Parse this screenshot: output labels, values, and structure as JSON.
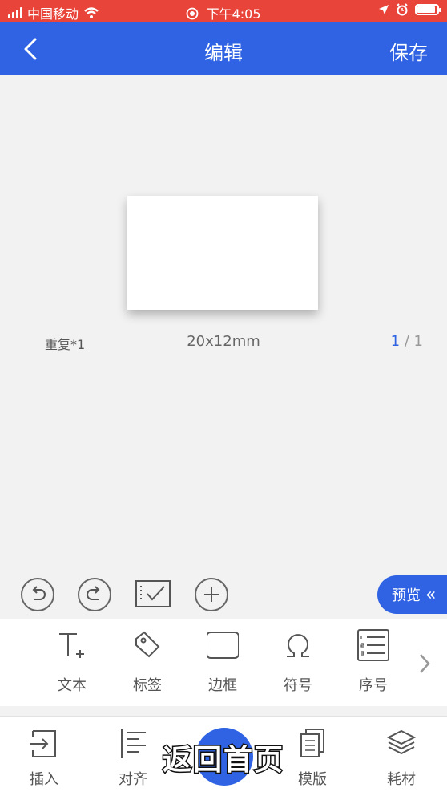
{
  "status_bar": {
    "carrier": "中国移动",
    "time": "下午4:05",
    "battery_percent": 90
  },
  "nav": {
    "title": "编辑",
    "save_label": "保存"
  },
  "canvas": {
    "repeat": "重复*1",
    "size": "20x12mm",
    "page_current": "1",
    "page_sep": " / ",
    "page_total": "1"
  },
  "preview": {
    "label": "预览",
    "icon": "«"
  },
  "tools": [
    {
      "label": "文本",
      "icon": "text-icon"
    },
    {
      "label": "标签",
      "icon": "tag-icon"
    },
    {
      "label": "边框",
      "icon": "border-icon"
    },
    {
      "label": "符号",
      "icon": "omega-icon"
    },
    {
      "label": "序号",
      "icon": "numbered-list-icon"
    }
  ],
  "tabs": [
    {
      "label": "插入",
      "icon": "insert-icon"
    },
    {
      "label": "对齐",
      "icon": "align-icon"
    },
    {
      "label": "模版",
      "icon": "template-icon"
    },
    {
      "label": "耗材",
      "icon": "consumables-icon"
    }
  ],
  "overlay_caption": "返回首页",
  "colors": {
    "primary": "#2f63e3",
    "status_bar": "#e8443a",
    "background": "#f2f2f2"
  }
}
